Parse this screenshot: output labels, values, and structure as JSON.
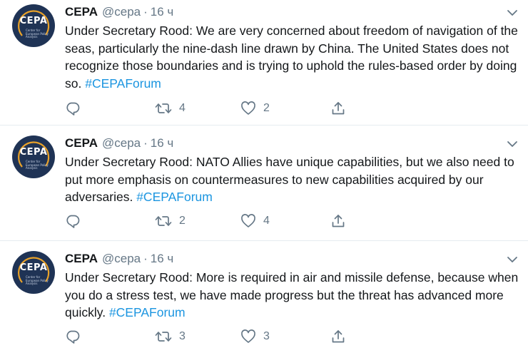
{
  "colors": {
    "text": "#14171a",
    "muted": "#657786",
    "hashtag": "#1b95e0",
    "divider": "#e6ecf0",
    "avatar_bg": "#1f3355",
    "avatar_ring": "#e8a22a"
  },
  "icons": {
    "reply": "reply-icon",
    "retweet": "retweet-icon",
    "like": "heart-icon",
    "share": "share-icon",
    "menu": "chevron-down-icon"
  },
  "tweets": [
    {
      "author": "CEPA",
      "handle": "@cepa",
      "dot": "·",
      "time": "16 ч",
      "avatar_text": "CEPA",
      "avatar_sub": "Center for European Policy Analysis",
      "text": "Under Secretary Rood: We are very concerned about freedom of navigation of the seas, particularly the nine-dash line drawn by China. The United States does not recognize those boundaries and is trying to uphold the rules-based order by doing so.",
      "hashtag": "#CEPAForum",
      "retweets": "4",
      "likes": "2"
    },
    {
      "author": "CEPA",
      "handle": "@cepa",
      "dot": "·",
      "time": "16 ч",
      "avatar_text": "CEPA",
      "avatar_sub": "Center for European Policy Analysis",
      "text": "Under Secretary Rood: NATO Allies have unique capabilities, but we also need to put more emphasis on countermeasures to new capabilities acquired by our adversaries.",
      "hashtag": "#CEPAForum",
      "retweets": "2",
      "likes": "4"
    },
    {
      "author": "CEPA",
      "handle": "@cepa",
      "dot": "·",
      "time": "16 ч",
      "avatar_text": "CEPA",
      "avatar_sub": "Center for European Policy Analysis",
      "text": "Under Secretary Rood: More is required in air and missile defense, because when you do a stress test, we have made progress but the threat has advanced more quickly.",
      "hashtag": "#CEPAForum",
      "retweets": "3",
      "likes": "3"
    }
  ]
}
